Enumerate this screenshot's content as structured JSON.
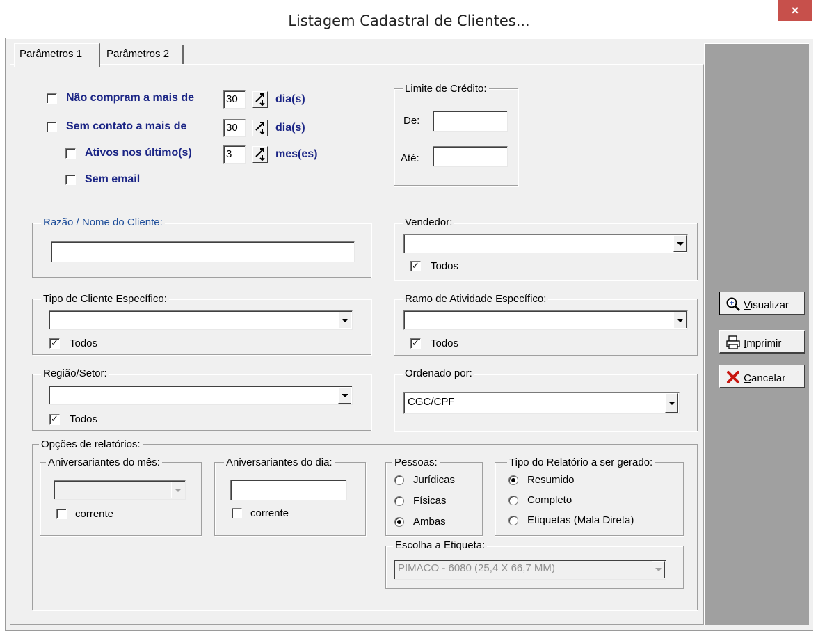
{
  "window": {
    "title": "Listagem Cadastral de Clientes...",
    "close_glyph": "×"
  },
  "tabs": [
    {
      "label": "Parâmetros 1"
    },
    {
      "label": "Parâmetros 2"
    }
  ],
  "filters": {
    "nao_compram": {
      "label": "Não compram a mais de",
      "value": "30",
      "unit": "dia(s)",
      "checked": false
    },
    "sem_contato": {
      "label": "Sem contato a mais de",
      "value": "30",
      "unit": "dia(s)",
      "checked": false
    },
    "ativos": {
      "label": "Ativos nos último(s)",
      "value": "3",
      "unit": "mes(es)",
      "checked": false
    },
    "sem_email": {
      "label": "Sem email",
      "checked": false
    }
  },
  "limite_credito": {
    "legend": "Limite de Crédito:",
    "de_label": "De:",
    "de_value": "",
    "ate_label": "Até:",
    "ate_value": ""
  },
  "razao": {
    "legend": "Razão / Nome do Cliente:",
    "value": ""
  },
  "vendedor": {
    "legend": "Vendedor:",
    "value": "",
    "todos_label": "Todos",
    "todos_checked": true
  },
  "tipo_cliente": {
    "legend": "Tipo de Cliente Específico:",
    "value": "",
    "todos_label": "Todos",
    "todos_checked": true
  },
  "ramo": {
    "legend": "Ramo de Atividade Específico:",
    "value": "",
    "todos_label": "Todos",
    "todos_checked": true
  },
  "regiao": {
    "legend": "Região/Setor:",
    "value": "",
    "todos_label": "Todos",
    "todos_checked": true
  },
  "ordenado": {
    "legend": "Ordenado por:",
    "value": "CGC/CPF"
  },
  "opcoes": {
    "legend": "Opções de relatórios:",
    "aniv_mes": {
      "legend": "Aniversariantes do mês:",
      "value": "",
      "corrente_label": "corrente",
      "corrente_checked": false
    },
    "aniv_dia": {
      "legend": "Aniversariantes do dia:",
      "value": "",
      "corrente_label": "corrente",
      "corrente_checked": false
    },
    "pessoas": {
      "legend": "Pessoas:",
      "options": [
        {
          "label": "Jurídicas",
          "selected": false
        },
        {
          "label": "Físicas",
          "selected": false
        },
        {
          "label": "Ambas",
          "selected": true
        }
      ]
    },
    "tipo_relatorio": {
      "legend": "Tipo do Relatório a ser gerado:",
      "options": [
        {
          "label": "Resumido",
          "selected": true
        },
        {
          "label": "Completo",
          "selected": false
        },
        {
          "label": "Etiquetas (Mala Direta)",
          "selected": false
        }
      ]
    },
    "etiqueta": {
      "legend": "Escolha a Etiqueta:",
      "value": "PIMACO - 6080 (25,4 X 66,7 MM)"
    }
  },
  "buttons": {
    "visualizar": {
      "label_first": "V",
      "label_rest": "isualizar"
    },
    "imprimir": {
      "label_first": "I",
      "label_rest": "mprimir"
    },
    "cancelar": {
      "label_first": "C",
      "label_rest": "ancelar"
    }
  },
  "colors": {
    "blue_label": "#1b2585",
    "panel_gray": "#a0a0a0",
    "close_red": "#c7504b",
    "field_blue": "#1f4e9a"
  }
}
